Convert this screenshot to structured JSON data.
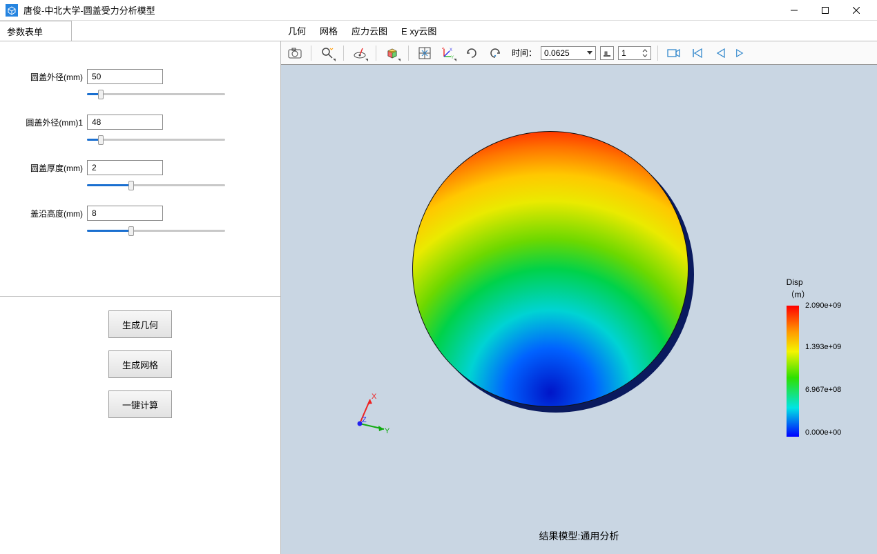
{
  "window": {
    "title": "唐俊-中北大学-圆盖受力分析模型"
  },
  "leftTab": "参数表单",
  "topTabs": [
    "几何",
    "网格",
    "应力云图",
    "E xy云图"
  ],
  "params": [
    {
      "label": "圆盖外径(mm)",
      "value": "50",
      "fillPct": 10
    },
    {
      "label": "圆盖外径(mm)1",
      "value": "48",
      "fillPct": 10
    },
    {
      "label": "圆盖厚度(mm)",
      "value": "2",
      "fillPct": 32
    },
    {
      "label": "盖沿高度(mm)",
      "value": "8",
      "fillPct": 32
    }
  ],
  "buttons": {
    "genGeom": "生成几何",
    "genMesh": "生成网格",
    "compute": "一键计算"
  },
  "toolbar": {
    "timeLabel": "时间：",
    "timeValue": "0.0625",
    "stepValue": "1"
  },
  "axes": {
    "x": "X",
    "y": "Y",
    "z": "Z"
  },
  "legend": {
    "title1": "Disp",
    "title2": "（m）",
    "ticks": [
      "2.090e+09",
      "1.393e+09",
      "6.967e+08",
      "0.000e+00"
    ]
  },
  "resultCaption": "结果模型:通用分析"
}
